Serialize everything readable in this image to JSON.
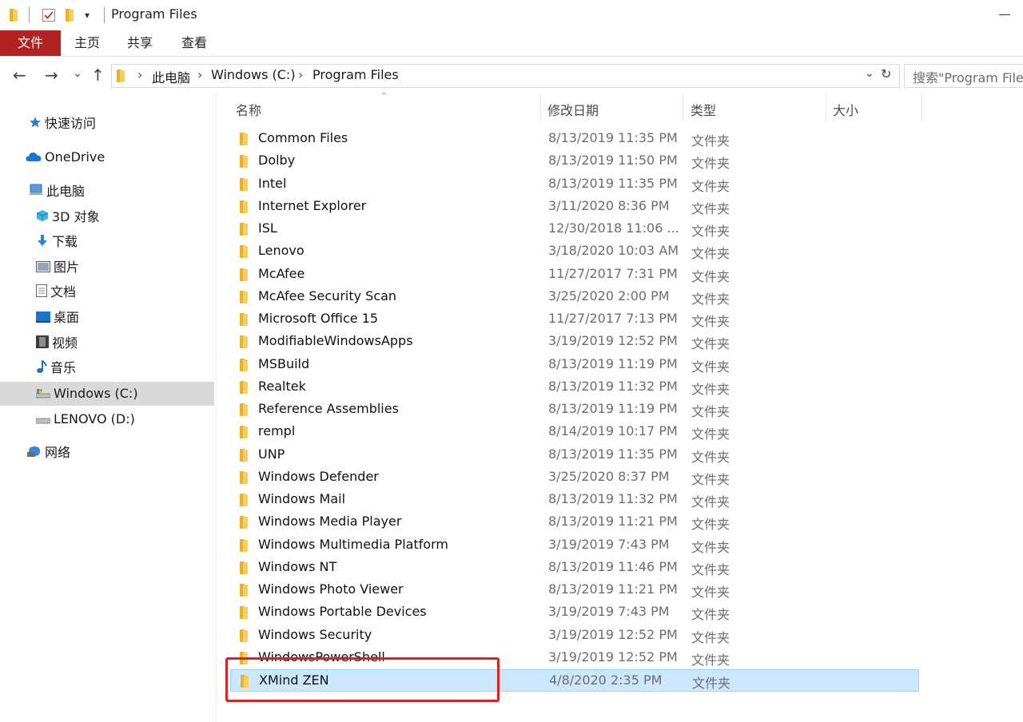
{
  "window": {
    "title": "Program Files"
  },
  "ribbon": {
    "tabs": [
      "文件",
      "主页",
      "共享",
      "查看"
    ]
  },
  "address": {
    "breadcrumb": [
      "此电脑",
      "Windows (C:)",
      "Program Files"
    ],
    "search_placeholder": "搜索\"Program Files\""
  },
  "icons": {
    "back": "←",
    "forward": "→",
    "recent": "⌄",
    "up": "↑",
    "dropdown": "⌄",
    "refresh": "↻",
    "sort_up": "^"
  },
  "nav": {
    "quick_access": "快速访问",
    "onedrive": "OneDrive",
    "this_pc": "此电脑",
    "items": [
      "3D 对象",
      "下载",
      "图片",
      "文档",
      "桌面",
      "视频",
      "音乐",
      "Windows (C:)",
      "LENOVO (D:)"
    ],
    "network": "网络"
  },
  "columns": {
    "name": "名称",
    "date": "修改日期",
    "type": "类型",
    "size": "大小"
  },
  "files": [
    {
      "name": "Common Files",
      "date": "8/13/2019 11:35 PM",
      "type": "文件夹"
    },
    {
      "name": "Dolby",
      "date": "8/13/2019 11:50 PM",
      "type": "文件夹"
    },
    {
      "name": "Intel",
      "date": "8/13/2019 11:35 PM",
      "type": "文件夹"
    },
    {
      "name": "Internet Explorer",
      "date": "3/11/2020 8:36 PM",
      "type": "文件夹"
    },
    {
      "name": "ISL",
      "date": "12/30/2018 11:06 ...",
      "type": "文件夹"
    },
    {
      "name": "Lenovo",
      "date": "3/18/2020 10:03 AM",
      "type": "文件夹"
    },
    {
      "name": "McAfee",
      "date": "11/27/2017 7:31 PM",
      "type": "文件夹"
    },
    {
      "name": "McAfee Security Scan",
      "date": "3/25/2020 2:00 PM",
      "type": "文件夹"
    },
    {
      "name": "Microsoft Office 15",
      "date": "11/27/2017 7:13 PM",
      "type": "文件夹"
    },
    {
      "name": "ModifiableWindowsApps",
      "date": "3/19/2019 12:52 PM",
      "type": "文件夹"
    },
    {
      "name": "MSBuild",
      "date": "8/13/2019 11:19 PM",
      "type": "文件夹"
    },
    {
      "name": "Realtek",
      "date": "8/13/2019 11:32 PM",
      "type": "文件夹"
    },
    {
      "name": "Reference Assemblies",
      "date": "8/13/2019 11:19 PM",
      "type": "文件夹"
    },
    {
      "name": "rempl",
      "date": "8/14/2019 10:17 PM",
      "type": "文件夹"
    },
    {
      "name": "UNP",
      "date": "8/13/2019 11:35 PM",
      "type": "文件夹"
    },
    {
      "name": "Windows Defender",
      "date": "3/25/2020 8:37 PM",
      "type": "文件夹"
    },
    {
      "name": "Windows Mail",
      "date": "8/13/2019 11:32 PM",
      "type": "文件夹"
    },
    {
      "name": "Windows Media Player",
      "date": "8/13/2019 11:21 PM",
      "type": "文件夹"
    },
    {
      "name": "Windows Multimedia Platform",
      "date": "3/19/2019 7:43 PM",
      "type": "文件夹"
    },
    {
      "name": "Windows NT",
      "date": "8/13/2019 11:46 PM",
      "type": "文件夹"
    },
    {
      "name": "Windows Photo Viewer",
      "date": "8/13/2019 11:21 PM",
      "type": "文件夹"
    },
    {
      "name": "Windows Portable Devices",
      "date": "3/19/2019 7:43 PM",
      "type": "文件夹"
    },
    {
      "name": "Windows Security",
      "date": "3/19/2019 12:52 PM",
      "type": "文件夹"
    },
    {
      "name": "WindowsPowerShell",
      "date": "3/19/2019 12:52 PM",
      "type": "文件夹"
    },
    {
      "name": "XMind ZEN",
      "date": "4/8/2020 2:35 PM",
      "type": "文件夹",
      "selected": true
    }
  ]
}
